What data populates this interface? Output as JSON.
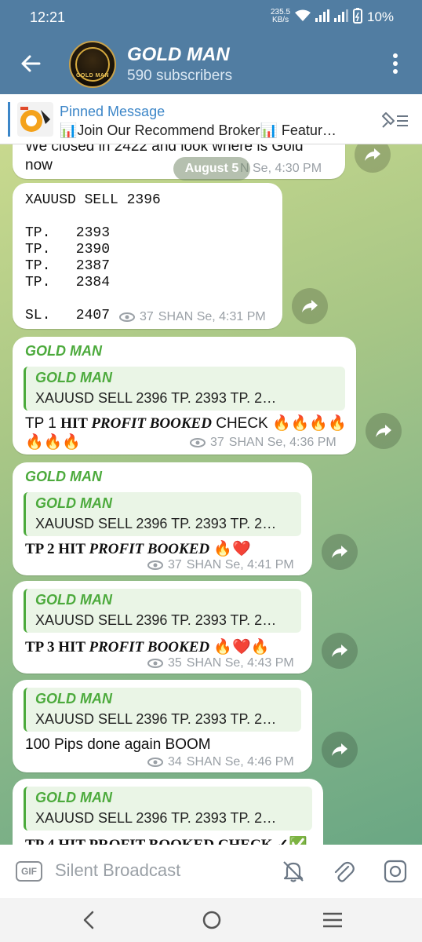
{
  "status_bar": {
    "time": "12:21",
    "net_speed": "235.5",
    "net_unit": "KB/s",
    "battery": "10%"
  },
  "header": {
    "channel_name": "GOLD MAN",
    "subscribers": "590 subscribers",
    "avatar_text": "GOLD MAN"
  },
  "pinned": {
    "title": "Pinned Message",
    "text": "📊Join Our Recommend Broker📊 Featur…"
  },
  "date_pill": "August 5",
  "messages": [
    {
      "partial_text": "We closed in 2422 and look where is Gold",
      "text_line2": "now",
      "meta_partial": "N Se, 4:30 PM"
    },
    {
      "code_text": "XAUUSD SELL 2396\n\nTP.   2393\nTP.   2390\nTP.   2387\nTP.   2384\n\nSL.   2407",
      "views": "37",
      "meta": "SHAN Se, 4:31 PM"
    },
    {
      "sender": "GOLD MAN",
      "quote_name": "GOLD MAN",
      "quote_text": "XAUUSD SELL 2396  TP.   2393 TP.   2…",
      "text_a": "TP 1 ",
      "text_b": "HIT ",
      "text_c": "PROFIT BOOKED",
      "text_d": " CHECK 🔥🔥🔥🔥",
      "text_line2": "🔥🔥🔥",
      "views": "37",
      "meta": "SHAN Se, 4:36 PM"
    },
    {
      "sender": "GOLD MAN",
      "quote_name": "GOLD MAN",
      "quote_text": "XAUUSD SELL 2396  TP.   2393 TP.   2…",
      "text_a": "TP 2 HIT ",
      "text_c": "PROFIT BOOKED",
      "text_d": " 🔥❤️",
      "views": "37",
      "meta": "SHAN Se, 4:41 PM"
    },
    {
      "quote_name": "GOLD MAN",
      "quote_text": "XAUUSD SELL 2396  TP.   2393 TP.   2…",
      "text_a": "TP 3 HIT ",
      "text_c": "PROFIT BOOKED",
      "text_d": " 🔥❤️🔥",
      "views": "35",
      "meta": "SHAN Se, 4:43 PM"
    },
    {
      "quote_name": "GOLD MAN",
      "quote_text": "XAUUSD SELL 2396  TP.   2393 TP.   2…",
      "text": "100 Pips done again BOOM",
      "views": "34",
      "meta": "SHAN Se, 4:46 PM"
    },
    {
      "quote_name": "GOLD MAN",
      "quote_text": "XAUUSD SELL 2396  TP.   2393 TP.   2…",
      "text_partial": "TP 4 HIT PROFIT BOOKED CHECK ✓✅"
    }
  ],
  "input": {
    "gif_label": "GIF",
    "placeholder": "Silent Broadcast"
  },
  "colors": {
    "header_bg": "#517da2",
    "accent_green": "#4caa3c",
    "link_blue": "#3c86c8"
  }
}
